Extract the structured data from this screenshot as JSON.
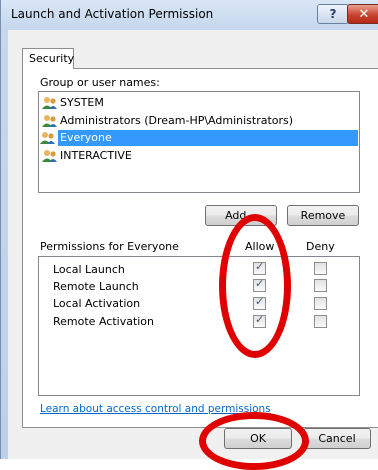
{
  "window": {
    "title": "Launch and Activation Permission",
    "help_label": "?",
    "close_label": "✕"
  },
  "tabs": [
    {
      "label": "Security"
    }
  ],
  "group_section": {
    "label": "Group or user names:",
    "items": [
      {
        "label": "SYSTEM",
        "icon": "users-icon",
        "selected": false
      },
      {
        "label": "Administrators (Dream-HP\\Administrators)",
        "icon": "users-icon",
        "selected": false
      },
      {
        "label": "Everyone",
        "icon": "users-icon",
        "selected": true
      },
      {
        "label": "INTERACTIVE",
        "icon": "users-icon",
        "selected": false
      }
    ],
    "add_label": "Add...",
    "remove_label": "Remove"
  },
  "permissions_section": {
    "label": "Permissions for Everyone",
    "allow_header": "Allow",
    "deny_header": "Deny",
    "rows": [
      {
        "name": "Local Launch",
        "allow": true,
        "deny": false
      },
      {
        "name": "Remote Launch",
        "allow": true,
        "deny": false
      },
      {
        "name": "Local Activation",
        "allow": true,
        "deny": false
      },
      {
        "name": "Remote Activation",
        "allow": true,
        "deny": false
      }
    ]
  },
  "link_text": "Learn about access control and permissions",
  "footer": {
    "ok_label": "OK",
    "cancel_label": "Cancel"
  },
  "highlight_color": "#e00000"
}
